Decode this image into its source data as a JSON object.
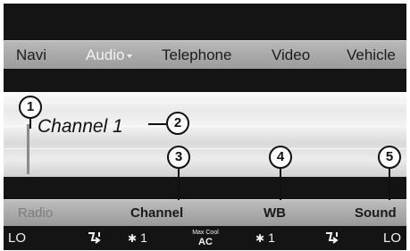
{
  "menu": {
    "items": [
      {
        "label": "Navi"
      },
      {
        "label": "Audio"
      },
      {
        "label": "Telephone"
      },
      {
        "label": "Video"
      },
      {
        "label": "Vehicle"
      }
    ]
  },
  "display": {
    "station": "Channel 1"
  },
  "function_bar": {
    "items": [
      {
        "label": "Radio"
      },
      {
        "label": "Channel"
      },
      {
        "label": "WB"
      },
      {
        "label": "Sound"
      }
    ]
  },
  "climate": {
    "left_temp": "LO",
    "left_fan": "1",
    "ac_top": "Max Cool",
    "ac_bottom": "AC",
    "right_fan": "1",
    "right_temp": "LO"
  },
  "callouts": [
    "1",
    "2",
    "3",
    "4",
    "5"
  ]
}
